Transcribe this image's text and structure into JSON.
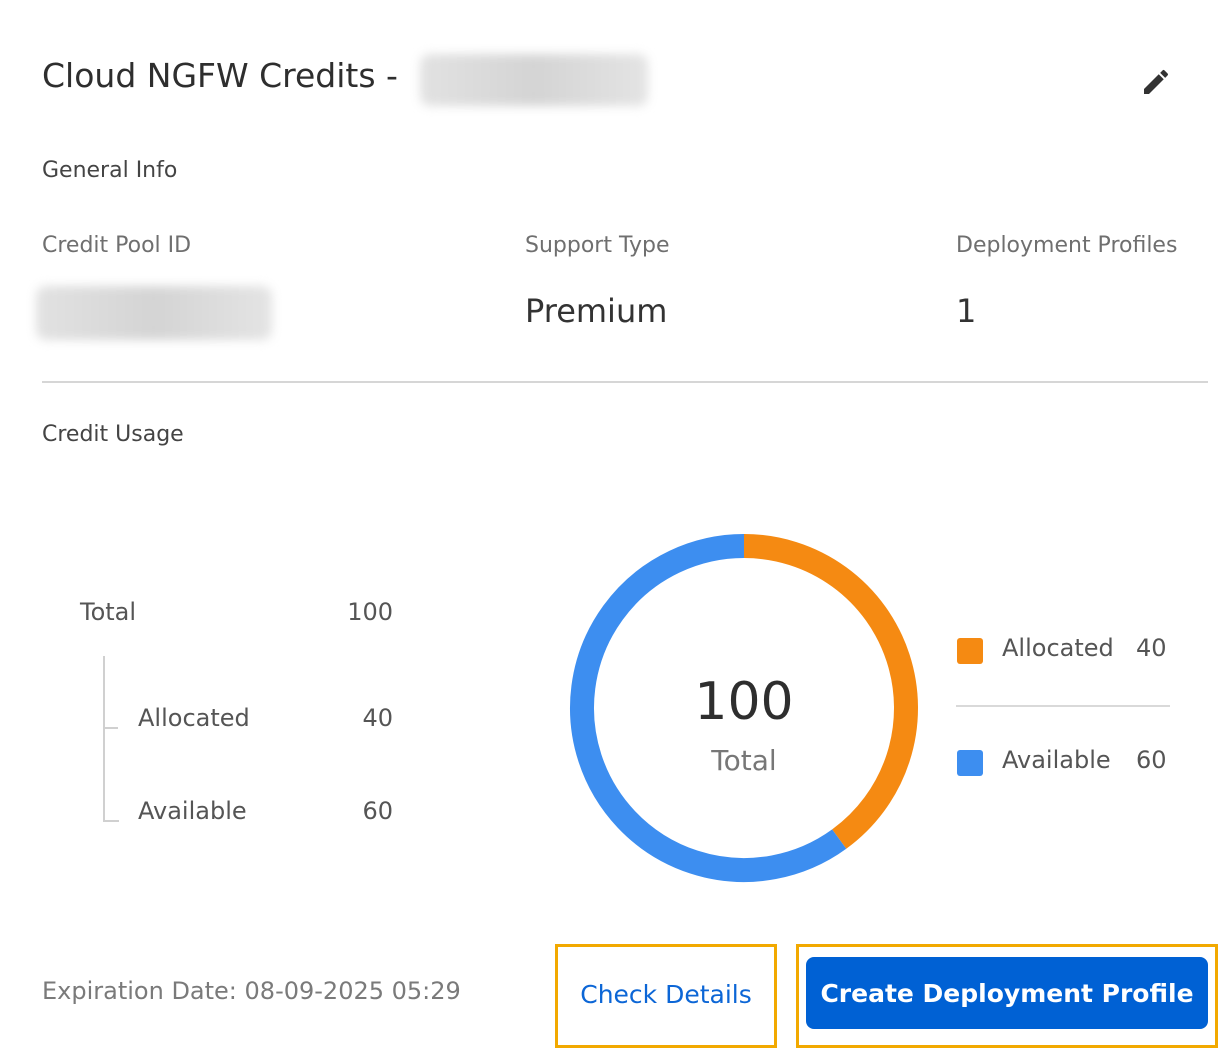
{
  "header": {
    "title": "Cloud NGFW Credits -",
    "edit_icon": "pencil-icon"
  },
  "general_info": {
    "heading": "General Info",
    "credit_pool_id_label": "Credit Pool ID",
    "support_type_label": "Support Type",
    "support_type_value": "Premium",
    "deployment_profiles_label": "Deployment Profiles",
    "deployment_profiles_value": "1"
  },
  "credit_usage": {
    "heading": "Credit Usage",
    "total_label": "Total",
    "total_value": "100",
    "allocated_label": "Allocated",
    "allocated_value": "40",
    "available_label": "Available",
    "available_value": "60"
  },
  "chart_data": {
    "type": "pie",
    "categories": [
      "Allocated",
      "Available"
    ],
    "values": [
      40,
      60
    ],
    "colors": [
      "#f58a12",
      "#3d8ef0"
    ],
    "center_value": "100",
    "center_label": "Total",
    "legend_position": "right"
  },
  "footer": {
    "expiration": "Expiration Date: 08-09-2025 05:29",
    "check_details_label": "Check Details",
    "create_profile_label": "Create Deployment Profile"
  }
}
